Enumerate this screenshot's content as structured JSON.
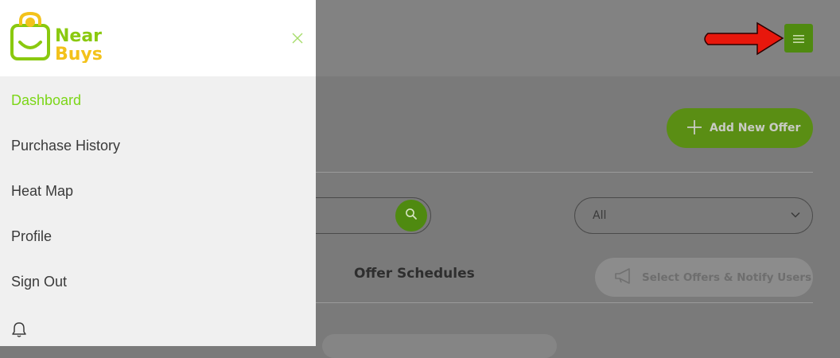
{
  "brand": {
    "line1": "Near",
    "line2": "Buys",
    "color_green": "#8ac90f",
    "color_yellow": "#f3c21b"
  },
  "sidebar": {
    "items": [
      {
        "label": "Dashboard",
        "active": true
      },
      {
        "label": "Purchase History",
        "active": false
      },
      {
        "label": "Heat Map",
        "active": false
      },
      {
        "label": "Profile",
        "active": false
      },
      {
        "label": "Sign Out",
        "active": false
      }
    ],
    "close_icon": "close-icon",
    "bell_icon": "bell-icon"
  },
  "header": {
    "menu_icon": "hamburger-icon",
    "annotation_arrow": "red-arrow"
  },
  "main": {
    "add_button_label": "Add New Offer",
    "search_icon": "search-icon",
    "filter_select_value": "All",
    "tab_title": "Offer Schedules",
    "notify_button_label": "Select Offers & Notify Users"
  },
  "colors": {
    "accent": "#7cd618",
    "overlay_button": "#4f8a10",
    "arrow": "#e8170c"
  }
}
